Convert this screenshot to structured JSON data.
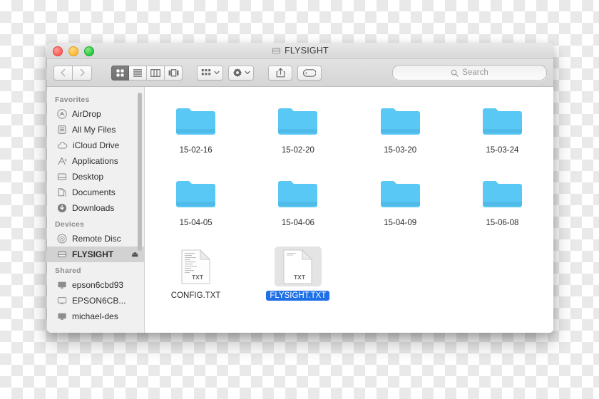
{
  "window": {
    "title": "FLYSIGHT",
    "title_icon": "hard-drive-icon",
    "traffic_lights": [
      {
        "name": "close-button",
        "color": "#ff5f57"
      },
      {
        "name": "minimize-button",
        "color": "#febc2e"
      },
      {
        "name": "maximize-button",
        "color": "#28c840"
      }
    ]
  },
  "toolbar": {
    "back_label": "Back",
    "forward_label": "Forward",
    "view_modes": [
      {
        "name": "icon-view",
        "label": "Icon View",
        "active": true
      },
      {
        "name": "list-view",
        "label": "List View",
        "active": false
      },
      {
        "name": "column-view",
        "label": "Column View",
        "active": false
      },
      {
        "name": "coverflow-view",
        "label": "Cover Flow View",
        "active": false
      }
    ],
    "arrange_label": "Arrange",
    "action_label": "Action",
    "share_label": "Share",
    "tag_label": "Edit Tags"
  },
  "search": {
    "placeholder": "Search",
    "value": ""
  },
  "sidebar": {
    "sections": [
      {
        "header": "Favorites",
        "items": [
          {
            "label": "AirDrop",
            "icon": "airdrop-icon",
            "selected": false
          },
          {
            "label": "All My Files",
            "icon": "all-my-files-icon",
            "selected": false
          },
          {
            "label": "iCloud Drive",
            "icon": "icloud-icon",
            "selected": false
          },
          {
            "label": "Applications",
            "icon": "applications-icon",
            "selected": false
          },
          {
            "label": "Desktop",
            "icon": "desktop-icon",
            "selected": false
          },
          {
            "label": "Documents",
            "icon": "documents-icon",
            "selected": false
          },
          {
            "label": "Downloads",
            "icon": "downloads-icon",
            "selected": false
          }
        ]
      },
      {
        "header": "Devices",
        "items": [
          {
            "label": "Remote Disc",
            "icon": "disc-icon",
            "selected": false
          },
          {
            "label": "FLYSIGHT",
            "icon": "hard-drive-icon",
            "selected": true,
            "eject": "⏏"
          }
        ]
      },
      {
        "header": "Shared",
        "items": [
          {
            "label": "epson6cbd93",
            "icon": "display-icon",
            "selected": false
          },
          {
            "label": "EPSON6CB...",
            "icon": "display-icon",
            "selected": false
          },
          {
            "label": "michael-des",
            "icon": "display-icon",
            "selected": false
          }
        ]
      }
    ]
  },
  "content": {
    "items": [
      {
        "name": "15-02-16",
        "type": "folder",
        "selected": false
      },
      {
        "name": "15-02-20",
        "type": "folder",
        "selected": false
      },
      {
        "name": "15-03-20",
        "type": "folder",
        "selected": false
      },
      {
        "name": "15-03-24",
        "type": "folder",
        "selected": false
      },
      {
        "name": "15-04-05",
        "type": "folder",
        "selected": false
      },
      {
        "name": "15-04-06",
        "type": "folder",
        "selected": false
      },
      {
        "name": "15-04-09",
        "type": "folder",
        "selected": false
      },
      {
        "name": "15-06-08",
        "type": "folder",
        "selected": false
      },
      {
        "name": "CONFIG.TXT",
        "type": "text-file",
        "badge": "TXT",
        "selected": false
      },
      {
        "name": "FLYSIGHT.TXT",
        "type": "text-file",
        "badge": "TXT",
        "selected": true
      }
    ]
  },
  "colors": {
    "folder_blue": "#5ac8f5",
    "selection_blue": "#1f6fe5",
    "sidebar_bg": "#f0f0f0",
    "sidebar_selected": "#d2d2d2"
  }
}
